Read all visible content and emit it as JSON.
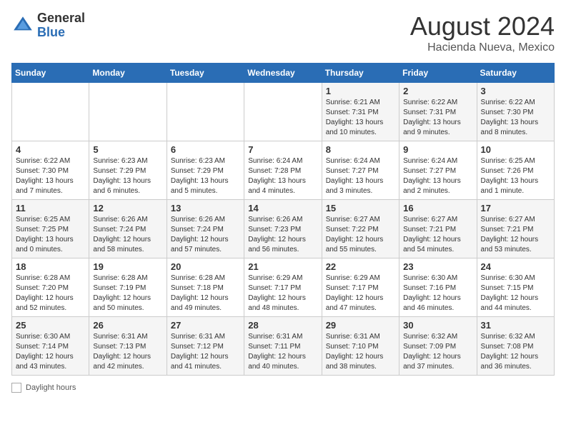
{
  "header": {
    "logo_general": "General",
    "logo_blue": "Blue",
    "month_title": "August 2024",
    "subtitle": "Hacienda Nueva, Mexico"
  },
  "days_of_week": [
    "Sunday",
    "Monday",
    "Tuesday",
    "Wednesday",
    "Thursday",
    "Friday",
    "Saturday"
  ],
  "weeks": [
    [
      {
        "day": "",
        "info": ""
      },
      {
        "day": "",
        "info": ""
      },
      {
        "day": "",
        "info": ""
      },
      {
        "day": "",
        "info": ""
      },
      {
        "day": "1",
        "info": "Sunrise: 6:21 AM\nSunset: 7:31 PM\nDaylight: 13 hours and 10 minutes."
      },
      {
        "day": "2",
        "info": "Sunrise: 6:22 AM\nSunset: 7:31 PM\nDaylight: 13 hours and 9 minutes."
      },
      {
        "day": "3",
        "info": "Sunrise: 6:22 AM\nSunset: 7:30 PM\nDaylight: 13 hours and 8 minutes."
      }
    ],
    [
      {
        "day": "4",
        "info": "Sunrise: 6:22 AM\nSunset: 7:30 PM\nDaylight: 13 hours and 7 minutes."
      },
      {
        "day": "5",
        "info": "Sunrise: 6:23 AM\nSunset: 7:29 PM\nDaylight: 13 hours and 6 minutes."
      },
      {
        "day": "6",
        "info": "Sunrise: 6:23 AM\nSunset: 7:29 PM\nDaylight: 13 hours and 5 minutes."
      },
      {
        "day": "7",
        "info": "Sunrise: 6:24 AM\nSunset: 7:28 PM\nDaylight: 13 hours and 4 minutes."
      },
      {
        "day": "8",
        "info": "Sunrise: 6:24 AM\nSunset: 7:27 PM\nDaylight: 13 hours and 3 minutes."
      },
      {
        "day": "9",
        "info": "Sunrise: 6:24 AM\nSunset: 7:27 PM\nDaylight: 13 hours and 2 minutes."
      },
      {
        "day": "10",
        "info": "Sunrise: 6:25 AM\nSunset: 7:26 PM\nDaylight: 13 hours and 1 minute."
      }
    ],
    [
      {
        "day": "11",
        "info": "Sunrise: 6:25 AM\nSunset: 7:25 PM\nDaylight: 13 hours and 0 minutes."
      },
      {
        "day": "12",
        "info": "Sunrise: 6:26 AM\nSunset: 7:24 PM\nDaylight: 12 hours and 58 minutes."
      },
      {
        "day": "13",
        "info": "Sunrise: 6:26 AM\nSunset: 7:24 PM\nDaylight: 12 hours and 57 minutes."
      },
      {
        "day": "14",
        "info": "Sunrise: 6:26 AM\nSunset: 7:23 PM\nDaylight: 12 hours and 56 minutes."
      },
      {
        "day": "15",
        "info": "Sunrise: 6:27 AM\nSunset: 7:22 PM\nDaylight: 12 hours and 55 minutes."
      },
      {
        "day": "16",
        "info": "Sunrise: 6:27 AM\nSunset: 7:21 PM\nDaylight: 12 hours and 54 minutes."
      },
      {
        "day": "17",
        "info": "Sunrise: 6:27 AM\nSunset: 7:21 PM\nDaylight: 12 hours and 53 minutes."
      }
    ],
    [
      {
        "day": "18",
        "info": "Sunrise: 6:28 AM\nSunset: 7:20 PM\nDaylight: 12 hours and 52 minutes."
      },
      {
        "day": "19",
        "info": "Sunrise: 6:28 AM\nSunset: 7:19 PM\nDaylight: 12 hours and 50 minutes."
      },
      {
        "day": "20",
        "info": "Sunrise: 6:28 AM\nSunset: 7:18 PM\nDaylight: 12 hours and 49 minutes."
      },
      {
        "day": "21",
        "info": "Sunrise: 6:29 AM\nSunset: 7:17 PM\nDaylight: 12 hours and 48 minutes."
      },
      {
        "day": "22",
        "info": "Sunrise: 6:29 AM\nSunset: 7:17 PM\nDaylight: 12 hours and 47 minutes."
      },
      {
        "day": "23",
        "info": "Sunrise: 6:30 AM\nSunset: 7:16 PM\nDaylight: 12 hours and 46 minutes."
      },
      {
        "day": "24",
        "info": "Sunrise: 6:30 AM\nSunset: 7:15 PM\nDaylight: 12 hours and 44 minutes."
      }
    ],
    [
      {
        "day": "25",
        "info": "Sunrise: 6:30 AM\nSunset: 7:14 PM\nDaylight: 12 hours and 43 minutes."
      },
      {
        "day": "26",
        "info": "Sunrise: 6:31 AM\nSunset: 7:13 PM\nDaylight: 12 hours and 42 minutes."
      },
      {
        "day": "27",
        "info": "Sunrise: 6:31 AM\nSunset: 7:12 PM\nDaylight: 12 hours and 41 minutes."
      },
      {
        "day": "28",
        "info": "Sunrise: 6:31 AM\nSunset: 7:11 PM\nDaylight: 12 hours and 40 minutes."
      },
      {
        "day": "29",
        "info": "Sunrise: 6:31 AM\nSunset: 7:10 PM\nDaylight: 12 hours and 38 minutes."
      },
      {
        "day": "30",
        "info": "Sunrise: 6:32 AM\nSunset: 7:09 PM\nDaylight: 12 hours and 37 minutes."
      },
      {
        "day": "31",
        "info": "Sunrise: 6:32 AM\nSunset: 7:08 PM\nDaylight: 12 hours and 36 minutes."
      }
    ]
  ],
  "footer": {
    "label": "Daylight hours"
  }
}
